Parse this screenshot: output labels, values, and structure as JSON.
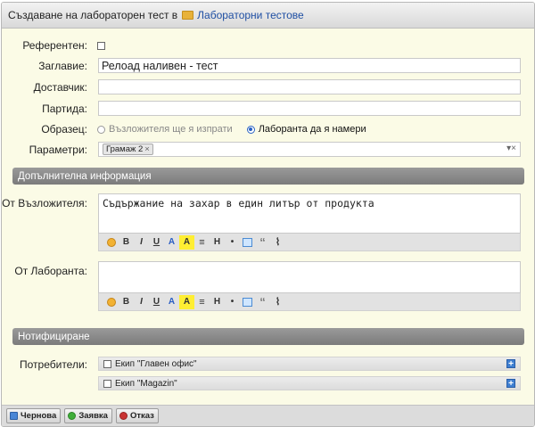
{
  "window": {
    "title": "Създаване на лабораторен тест в",
    "folder_link": "Лабораторни тестове"
  },
  "form": {
    "referent_label": "Референтен:",
    "title_label": "Заглавие:",
    "title_value": "Релоад наливен - тест",
    "supplier_label": "Доставчик:",
    "batch_label": "Партида:",
    "sample_label": "Образец:",
    "sample_opt1": "Възложителя ще я изпрати",
    "sample_opt2": "Лаборанта да я намери",
    "params_label": "Параметри:",
    "params_tag": "Грамаж 2",
    "params_tag_remove": "×",
    "params_controls": "▾×"
  },
  "section_extra": {
    "title": "Допълнителна информация",
    "from_client_label": "От Възложителя:",
    "from_client_value": "Съдържание на захар в един литър от продукта",
    "from_lab_label": "От Лаборанта:",
    "from_lab_value": ""
  },
  "editor_toolbar": [
    "emoji-icon",
    "B",
    "I",
    "U",
    "A",
    "A",
    "align-icon",
    "H",
    "•",
    "image-icon",
    "“",
    "attach-icon"
  ],
  "section_notify": {
    "title": "Нотифициране",
    "users_label": "Потребители:",
    "teams": [
      "Екип \"Главен офис\"",
      "Екип \"Magazin\""
    ]
  },
  "footer": {
    "draft": "Чернова",
    "request": "Заявка",
    "cancel": "Отказ"
  },
  "colors": {
    "form_bg": "#fbfbe6",
    "section_bg": "#8a8a8a",
    "link": "#1f4fa3",
    "accent_blue": "#3f7fd1"
  }
}
